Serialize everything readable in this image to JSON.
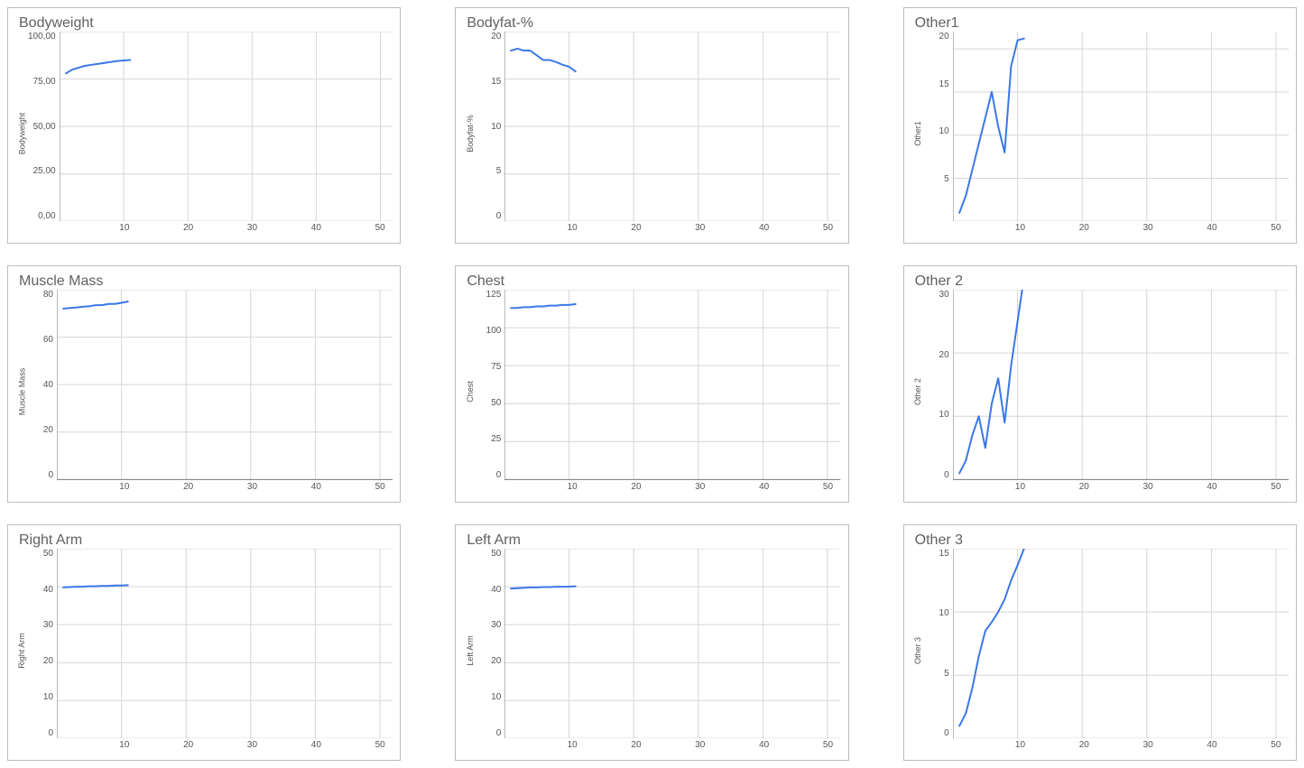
{
  "chart_data": [
    {
      "id": "bodyweight",
      "title": "Bodyweight",
      "ylabel": "Bodyweight",
      "type": "line",
      "xlim": [
        0,
        52
      ],
      "ylim": [
        0,
        100
      ],
      "xticks": [
        10,
        20,
        30,
        40,
        50
      ],
      "yticks": [
        "100,00",
        "75,00",
        "50,00",
        "25,00",
        "0,00"
      ],
      "ytick_vals": [
        100,
        75,
        50,
        25,
        0
      ],
      "x": [
        1,
        2,
        3,
        4,
        5,
        6,
        7,
        8,
        9,
        10,
        11
      ],
      "values": [
        78,
        80,
        81,
        82,
        82.5,
        83,
        83.5,
        84,
        84.5,
        84.8,
        85
      ]
    },
    {
      "id": "bodyfat",
      "title": "Bodyfat-%",
      "ylabel": "Bodyfat-%",
      "type": "line",
      "xlim": [
        0,
        52
      ],
      "ylim": [
        0,
        20
      ],
      "xticks": [
        10,
        20,
        30,
        40,
        50
      ],
      "yticks": [
        "20",
        "15",
        "10",
        "5",
        "0"
      ],
      "ytick_vals": [
        20,
        15,
        10,
        5,
        0
      ],
      "x": [
        1,
        2,
        3,
        4,
        5,
        6,
        7,
        8,
        9,
        10,
        11
      ],
      "values": [
        18,
        18.2,
        18,
        18,
        17.5,
        17,
        17,
        16.8,
        16.5,
        16.3,
        15.8
      ]
    },
    {
      "id": "other1",
      "title": "Other1",
      "ylabel": "Other1",
      "type": "line",
      "xlim": [
        0,
        52
      ],
      "ylim": [
        0,
        22
      ],
      "xticks": [
        10,
        20,
        30,
        40,
        50
      ],
      "yticks": [
        "20",
        "15",
        "10",
        "5",
        ""
      ],
      "ytick_vals": [
        20,
        15,
        10,
        5,
        0
      ],
      "x": [
        1,
        2,
        3,
        4,
        5,
        6,
        7,
        8,
        9,
        10,
        11
      ],
      "values": [
        1,
        3,
        6,
        9,
        12,
        15,
        11,
        8,
        18,
        21,
        21.2
      ]
    },
    {
      "id": "muscle-mass",
      "title": "Muscle Mass",
      "ylabel": "Muscle Mass",
      "type": "line",
      "xlim": [
        0,
        52
      ],
      "ylim": [
        0,
        80
      ],
      "xticks": [
        10,
        20,
        30,
        40,
        50
      ],
      "yticks": [
        "80",
        "60",
        "40",
        "20",
        "0"
      ],
      "ytick_vals": [
        80,
        60,
        40,
        20,
        0
      ],
      "x": [
        1,
        2,
        3,
        4,
        5,
        6,
        7,
        8,
        9,
        10,
        11
      ],
      "values": [
        72,
        72.3,
        72.5,
        72.8,
        73,
        73.5,
        73.5,
        74,
        74,
        74.5,
        75
      ]
    },
    {
      "id": "chest",
      "title": "Chest",
      "ylabel": "Chest",
      "type": "line",
      "xlim": [
        0,
        52
      ],
      "ylim": [
        0,
        125
      ],
      "xticks": [
        10,
        20,
        30,
        40,
        50
      ],
      "yticks": [
        "125",
        "100",
        "75",
        "50",
        "25",
        "0"
      ],
      "ytick_vals": [
        125,
        100,
        75,
        50,
        25,
        0
      ],
      "x": [
        1,
        2,
        3,
        4,
        5,
        6,
        7,
        8,
        9,
        10,
        11
      ],
      "values": [
        113,
        113,
        113.5,
        113.5,
        114,
        114,
        114.5,
        114.5,
        115,
        115,
        115.5
      ]
    },
    {
      "id": "other2",
      "title": "Other 2",
      "ylabel": "Other 2",
      "type": "line",
      "xlim": [
        0,
        52
      ],
      "ylim": [
        0,
        30
      ],
      "xticks": [
        10,
        20,
        30,
        40,
        50
      ],
      "yticks": [
        "30",
        "20",
        "10",
        "0"
      ],
      "ytick_vals": [
        30,
        20,
        10,
        0
      ],
      "x": [
        1,
        2,
        3,
        4,
        5,
        6,
        7,
        8,
        9,
        10,
        11
      ],
      "values": [
        1,
        3,
        7,
        10,
        5,
        12,
        16,
        9,
        18,
        25,
        32
      ]
    },
    {
      "id": "right-arm",
      "title": "Right Arm",
      "ylabel": "Right Arm",
      "type": "line",
      "xlim": [
        0,
        52
      ],
      "ylim": [
        0,
        50
      ],
      "xticks": [
        10,
        20,
        30,
        40,
        50
      ],
      "yticks": [
        "50",
        "40",
        "30",
        "20",
        "10",
        "0"
      ],
      "ytick_vals": [
        50,
        40,
        30,
        20,
        10,
        0
      ],
      "x": [
        1,
        2,
        3,
        4,
        5,
        6,
        7,
        8,
        9,
        10,
        11
      ],
      "values": [
        39.8,
        39.9,
        40,
        40,
        40.1,
        40.1,
        40.2,
        40.2,
        40.3,
        40.3,
        40.4
      ]
    },
    {
      "id": "left-arm",
      "title": "Left Arm",
      "ylabel": "Left Arm",
      "type": "line",
      "xlim": [
        0,
        52
      ],
      "ylim": [
        0,
        50
      ],
      "xticks": [
        10,
        20,
        30,
        40,
        50
      ],
      "yticks": [
        "50",
        "40",
        "30",
        "20",
        "10",
        "0"
      ],
      "ytick_vals": [
        50,
        40,
        30,
        20,
        10,
        0
      ],
      "x": [
        1,
        2,
        3,
        4,
        5,
        6,
        7,
        8,
        9,
        10,
        11
      ],
      "values": [
        39.5,
        39.6,
        39.7,
        39.8,
        39.8,
        39.9,
        39.9,
        40,
        40,
        40,
        40.1
      ]
    },
    {
      "id": "other3",
      "title": "Other 3",
      "ylabel": "Other 3",
      "type": "line",
      "xlim": [
        0,
        52
      ],
      "ylim": [
        0,
        15
      ],
      "xticks": [
        10,
        20,
        30,
        40,
        50
      ],
      "yticks": [
        "15",
        "10",
        "5",
        "0"
      ],
      "ytick_vals": [
        15,
        10,
        5,
        0
      ],
      "x": [
        1,
        2,
        3,
        4,
        5,
        6,
        7,
        8,
        9,
        10,
        11
      ],
      "values": [
        1,
        2,
        4,
        6.5,
        8.5,
        9.2,
        10,
        11,
        12.5,
        13.7,
        15
      ]
    }
  ],
  "colors": {
    "line": "#3b78e7",
    "grid": "#d6d6d6",
    "axis": "#777"
  }
}
